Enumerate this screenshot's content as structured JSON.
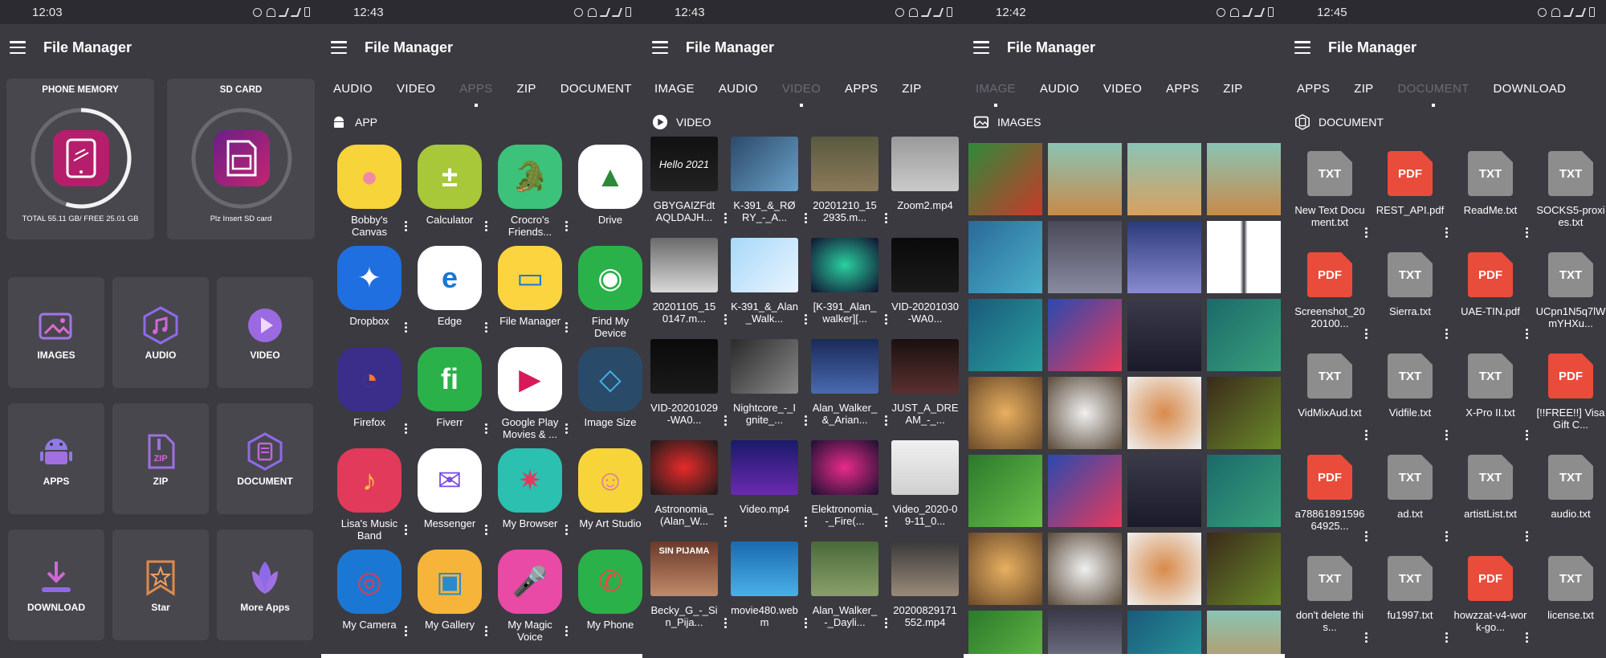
{
  "colors": {
    "bg": "#3b3a41",
    "card": "#48474e",
    "status": "#2c2b31",
    "accent_pink": "#d9267d",
    "pdf": "#ea4c3b",
    "txt": "#8d8d8d"
  },
  "app_title": "File Manager",
  "panels": [
    {
      "time": "12:03"
    },
    {
      "time": "12:43"
    },
    {
      "time": "12:43"
    },
    {
      "time": "12:42"
    },
    {
      "time": "12:45"
    }
  ],
  "p1": {
    "phone": {
      "title": "PHONE MEMORY",
      "info": "TOTAL 55.11 GB/ FREE 25.01 GB",
      "used_fraction": 0.55
    },
    "sd": {
      "title": "SD CARD",
      "info": "Plz Insert SD card"
    },
    "categories": [
      "IMAGES",
      "AUDIO",
      "VIDEO",
      "APPS",
      "ZIP",
      "DOCUMENT",
      "DOWNLOAD",
      "Star",
      "More Apps"
    ]
  },
  "p2": {
    "tabs": [
      "AUDIO",
      "VIDEO",
      "APPS",
      "ZIP",
      "DOCUMENT"
    ],
    "active_tab": 2,
    "section": "APP",
    "apps": [
      "Bobby's Canvas",
      "Calculator",
      "Crocro's Friends...",
      "Drive",
      "Dropbox",
      "Edge",
      "File Manager",
      "Find My Device",
      "Firefox",
      "Fiverr",
      "Google Play Movies & ...",
      "Image Size",
      "Lisa's Music Band",
      "Messenger",
      "My Browser",
      "My Art Studio",
      "My Camera",
      "My Gallery",
      "My Magic Voice",
      "My Phone"
    ]
  },
  "p3": {
    "tabs": [
      "IMAGE",
      "AUDIO",
      "VIDEO",
      "APPS",
      "ZIP"
    ],
    "active_tab": 2,
    "section": "VIDEO",
    "videos": [
      "GBYGAIZFdtAQLDAJH...",
      "K-391_&_RØRY_-_A...",
      "20201210_152935.m...",
      "Zoom2.mp4",
      "20201105_150147.m...",
      "K-391_&_Alan_Walk...",
      "[K-391_Alan_walker][...",
      "VID-20201030-WA0...",
      "VID-20201029-WA0...",
      "Nightcore_-_Ignite_...",
      "Alan_Walker_&_Arian...",
      "JUST_A_DREAM_-_...",
      "Astronomia_(Alan_W...",
      "Video.mp4",
      "Elektronomia_-_Fire(...",
      "Video_2020-09-11_0...",
      "Becky_G_-_Sin_Pija...",
      "movie480.webm",
      "Alan_Walker_-_Dayli...",
      "20200829171552.mp4"
    ],
    "thumb_text": {
      "hello": "Hello 2021",
      "sin": "SIN PIJAMA"
    }
  },
  "p4": {
    "tabs": [
      "IMAGE",
      "AUDIO",
      "VIDEO",
      "APPS",
      "ZIP"
    ],
    "active_tab": 0,
    "section": "IMAGES"
  },
  "p5": {
    "tabs": [
      "APPS",
      "ZIP",
      "DOCUMENT",
      "DOWNLOAD"
    ],
    "active_tab": 2,
    "section": "DOCUMENT",
    "docs": [
      {
        "type": "TXT",
        "name": "New Text Document.txt"
      },
      {
        "type": "PDF",
        "name": "REST_API.pdf"
      },
      {
        "type": "TXT",
        "name": "ReadMe.txt"
      },
      {
        "type": "TXT",
        "name": "SOCKS5-proxies.txt"
      },
      {
        "type": "PDF",
        "name": "Screenshot_2020100..."
      },
      {
        "type": "TXT",
        "name": "Sierra.txt"
      },
      {
        "type": "PDF",
        "name": "UAE-TIN.pdf"
      },
      {
        "type": "TXT",
        "name": "UCpn1N5q7lWmYHXu..."
      },
      {
        "type": "TXT",
        "name": "VidMixAud.txt"
      },
      {
        "type": "TXT",
        "name": "Vidfile.txt"
      },
      {
        "type": "TXT",
        "name": "X-Pro II.txt"
      },
      {
        "type": "PDF",
        "name": "[!!FREE!!] Visa Gift C..."
      },
      {
        "type": "PDF",
        "name": "a7886189159664925..."
      },
      {
        "type": "TXT",
        "name": "ad.txt"
      },
      {
        "type": "TXT",
        "name": "artistList.txt"
      },
      {
        "type": "TXT",
        "name": "audio.txt"
      },
      {
        "type": "TXT",
        "name": "don't delete this..."
      },
      {
        "type": "TXT",
        "name": "fu1997.txt"
      },
      {
        "type": "PDF",
        "name": "howzzat-v4-work-go..."
      },
      {
        "type": "TXT",
        "name": "license.txt"
      }
    ]
  }
}
